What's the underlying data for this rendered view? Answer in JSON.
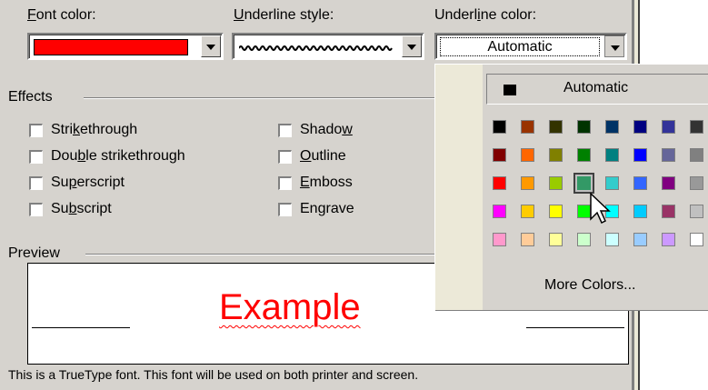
{
  "labels": {
    "font_color": "Font color:",
    "underline_style": "Underline style:",
    "underline_color": "Underline color:",
    "effects": "Effects",
    "preview": "Preview"
  },
  "font_color_value": "#ff0000",
  "underline_color_value": "Automatic",
  "effects": [
    {
      "label": "Strikethrough",
      "checked": false
    },
    {
      "label": "Double strikethrough",
      "checked": false
    },
    {
      "label": "Superscript",
      "checked": false
    },
    {
      "label": "Subscript",
      "checked": false
    },
    {
      "label": "Shadow",
      "checked": false
    },
    {
      "label": "Outline",
      "checked": false
    },
    {
      "label": "Emboss",
      "checked": false
    },
    {
      "label": "Engrave",
      "checked": false
    }
  ],
  "preview_text": "Example",
  "footer_text": "This is a TrueType font. This font will be used on both printer and screen.",
  "palette": {
    "automatic_label": "Automatic",
    "more_colors_label": "More Colors...",
    "selected_color": "#339966",
    "colors": [
      [
        "#000000",
        "#993300",
        "#333300",
        "#003300",
        "#003366",
        "#000080",
        "#333399",
        "#333333"
      ],
      [
        "#800000",
        "#ff6600",
        "#808000",
        "#008000",
        "#008080",
        "#0000ff",
        "#666699",
        "#808080"
      ],
      [
        "#ff0000",
        "#ff9900",
        "#99cc00",
        "#339966",
        "#33cccc",
        "#3366ff",
        "#800080",
        "#999999"
      ],
      [
        "#ff00ff",
        "#ffcc00",
        "#ffff00",
        "#00ff00",
        "#00ffff",
        "#00ccff",
        "#993366",
        "#c0c0c0"
      ],
      [
        "#ff99cc",
        "#ffcc99",
        "#ffff99",
        "#ccffcc",
        "#ccffff",
        "#99ccff",
        "#cc99ff",
        "#ffffff"
      ]
    ]
  }
}
